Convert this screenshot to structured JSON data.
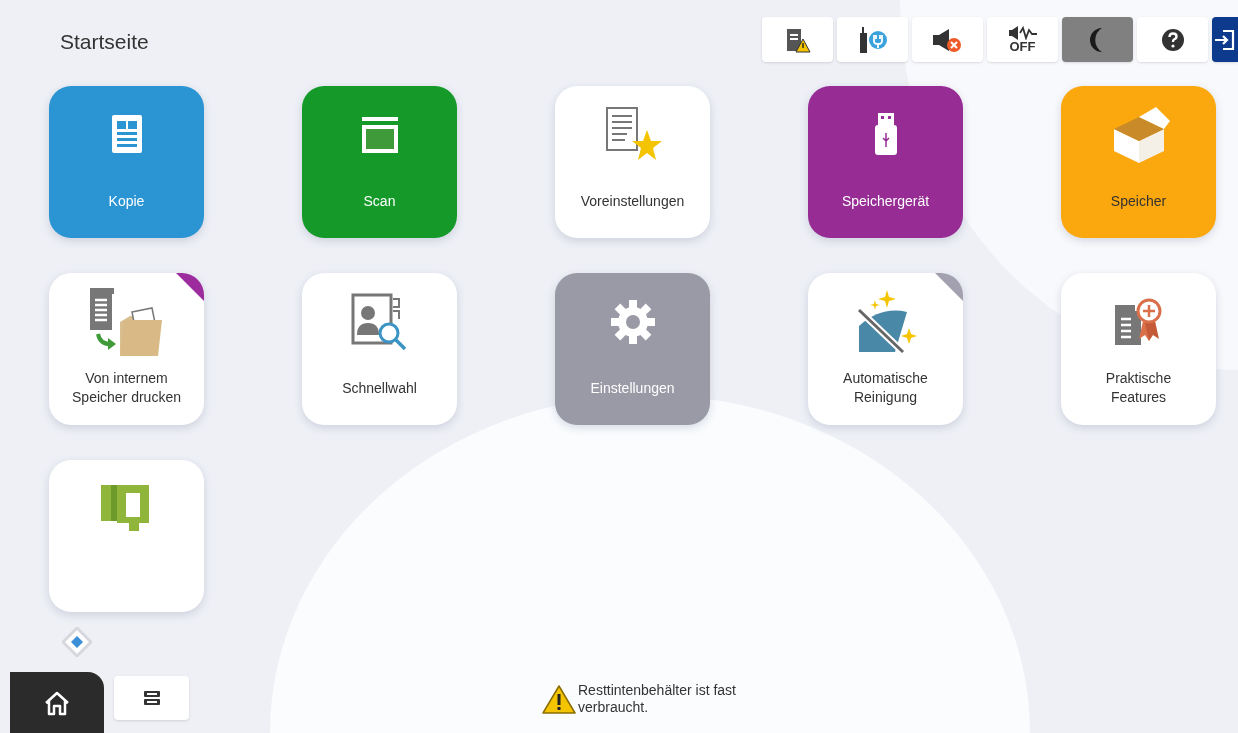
{
  "header": {
    "title": "Startseite"
  },
  "toolbar": [
    {
      "kind": "printer-warning",
      "active": false
    },
    {
      "kind": "wireless",
      "active": false
    },
    {
      "kind": "sound-off",
      "active": false
    },
    {
      "kind": "quiet-mode",
      "label": "OFF",
      "active": false
    },
    {
      "kind": "sleep",
      "active": true
    },
    {
      "kind": "help",
      "active": false
    },
    {
      "kind": "login",
      "active": false
    }
  ],
  "tiles": [
    {
      "kind": "copy",
      "label": "Kopie",
      "color": "#2b94d2"
    },
    {
      "kind": "scan",
      "label": "Scan",
      "color": "#159a2a"
    },
    {
      "kind": "presets",
      "label": "Voreinstellungen",
      "color": "#ffffff"
    },
    {
      "kind": "memory-device",
      "label": "Speichergerät",
      "color": "#962c94"
    },
    {
      "kind": "storage",
      "label": "Speicher",
      "color": "#fba70e"
    },
    {
      "kind": "print-from-storage",
      "label": "Von internem Speicher drucken",
      "color": "#ffffff",
      "corner": {
        "color": "#9c2b9e"
      }
    },
    {
      "kind": "speed-dial",
      "label": "Schnellwahl",
      "color": "#ffffff"
    },
    {
      "kind": "settings",
      "label": "Einstellungen",
      "color": "#9a99a6"
    },
    {
      "kind": "auto-clean",
      "label": "Automatische Reinigung",
      "color": "#ffffff",
      "corner": {
        "color": "#a3a1b0"
      }
    },
    {
      "kind": "features",
      "label": "Praktische Features",
      "color": "#ffffff"
    },
    {
      "kind": "iq",
      "color": "#ffffff"
    }
  ],
  "status_bar": {
    "message": "Resttintenbehälter ist fast verbraucht."
  }
}
